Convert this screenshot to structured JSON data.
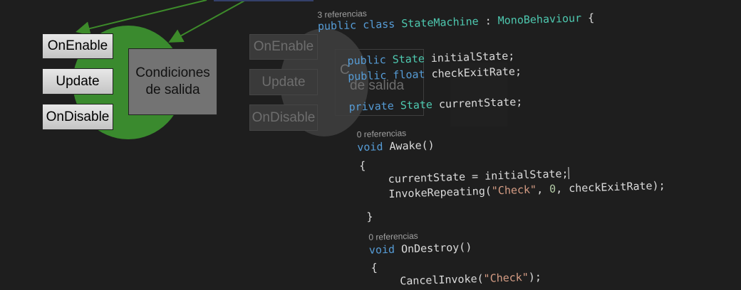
{
  "diagram": {
    "states": {
      "enable": "OnEnable",
      "update": "Update",
      "disable": "OnDisable"
    },
    "condition": {
      "line1": "Condiciones",
      "line2": "de salida"
    },
    "ghost": {
      "enable": "OnEnable",
      "update": "Update",
      "disable": "OnDisable",
      "cond_line1": "C",
      "cond_line2": "de salida"
    },
    "colors": {
      "node": "#3a8a2e",
      "arrow": "#3d8b2a",
      "ghost_node": "#3a3a3a"
    }
  },
  "code": {
    "lens": [
      "3 referencias",
      "0 referencias",
      "0 referencias"
    ],
    "tokens": {
      "public": "public",
      "class": "class",
      "private": "private",
      "void": "void",
      "float": "float",
      "state_type": "State",
      "state_machine": "StateMachine",
      "mono": "MonoBehaviour",
      "colon": " : ",
      "brace_open": "{",
      "brace_close": "}",
      "initial_state": "initialState;",
      "check_exit_rate": "checkExitRate;",
      "current_state": "currentState;",
      "awake": "Awake()",
      "assign": "currentState = initialState;",
      "invoke_repeating": "InvokeRepeating(",
      "check_str": "\"Check\"",
      "comma": ", ",
      "zero": "0",
      "rate_close": ", checkExitRate);",
      "on_destroy": "OnDestroy()",
      "cancel_invoke": "CancelInvoke(",
      "close_paren": ");"
    }
  }
}
